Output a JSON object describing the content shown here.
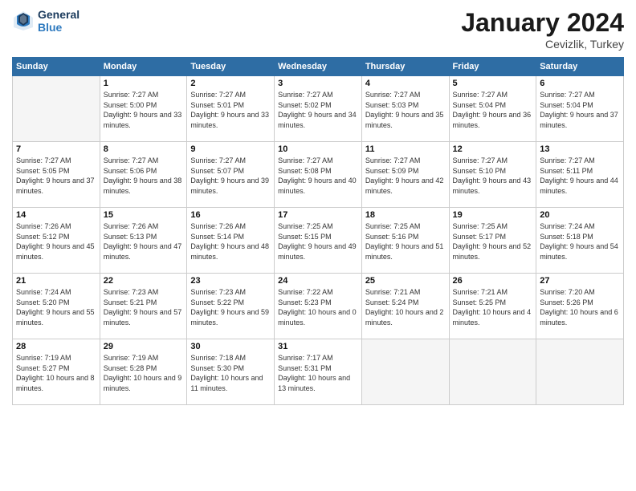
{
  "header": {
    "logo_line1": "General",
    "logo_line2": "Blue",
    "month": "January 2024",
    "location": "Cevizlik, Turkey"
  },
  "weekdays": [
    "Sunday",
    "Monday",
    "Tuesday",
    "Wednesday",
    "Thursday",
    "Friday",
    "Saturday"
  ],
  "weeks": [
    [
      {
        "day": "",
        "sunrise": "",
        "sunset": "",
        "daylight": ""
      },
      {
        "day": "1",
        "sunrise": "Sunrise: 7:27 AM",
        "sunset": "Sunset: 5:00 PM",
        "daylight": "Daylight: 9 hours and 33 minutes."
      },
      {
        "day": "2",
        "sunrise": "Sunrise: 7:27 AM",
        "sunset": "Sunset: 5:01 PM",
        "daylight": "Daylight: 9 hours and 33 minutes."
      },
      {
        "day": "3",
        "sunrise": "Sunrise: 7:27 AM",
        "sunset": "Sunset: 5:02 PM",
        "daylight": "Daylight: 9 hours and 34 minutes."
      },
      {
        "day": "4",
        "sunrise": "Sunrise: 7:27 AM",
        "sunset": "Sunset: 5:03 PM",
        "daylight": "Daylight: 9 hours and 35 minutes."
      },
      {
        "day": "5",
        "sunrise": "Sunrise: 7:27 AM",
        "sunset": "Sunset: 5:04 PM",
        "daylight": "Daylight: 9 hours and 36 minutes."
      },
      {
        "day": "6",
        "sunrise": "Sunrise: 7:27 AM",
        "sunset": "Sunset: 5:04 PM",
        "daylight": "Daylight: 9 hours and 37 minutes."
      }
    ],
    [
      {
        "day": "7",
        "sunrise": "Sunrise: 7:27 AM",
        "sunset": "Sunset: 5:05 PM",
        "daylight": "Daylight: 9 hours and 37 minutes."
      },
      {
        "day": "8",
        "sunrise": "Sunrise: 7:27 AM",
        "sunset": "Sunset: 5:06 PM",
        "daylight": "Daylight: 9 hours and 38 minutes."
      },
      {
        "day": "9",
        "sunrise": "Sunrise: 7:27 AM",
        "sunset": "Sunset: 5:07 PM",
        "daylight": "Daylight: 9 hours and 39 minutes."
      },
      {
        "day": "10",
        "sunrise": "Sunrise: 7:27 AM",
        "sunset": "Sunset: 5:08 PM",
        "daylight": "Daylight: 9 hours and 40 minutes."
      },
      {
        "day": "11",
        "sunrise": "Sunrise: 7:27 AM",
        "sunset": "Sunset: 5:09 PM",
        "daylight": "Daylight: 9 hours and 42 minutes."
      },
      {
        "day": "12",
        "sunrise": "Sunrise: 7:27 AM",
        "sunset": "Sunset: 5:10 PM",
        "daylight": "Daylight: 9 hours and 43 minutes."
      },
      {
        "day": "13",
        "sunrise": "Sunrise: 7:27 AM",
        "sunset": "Sunset: 5:11 PM",
        "daylight": "Daylight: 9 hours and 44 minutes."
      }
    ],
    [
      {
        "day": "14",
        "sunrise": "Sunrise: 7:26 AM",
        "sunset": "Sunset: 5:12 PM",
        "daylight": "Daylight: 9 hours and 45 minutes."
      },
      {
        "day": "15",
        "sunrise": "Sunrise: 7:26 AM",
        "sunset": "Sunset: 5:13 PM",
        "daylight": "Daylight: 9 hours and 47 minutes."
      },
      {
        "day": "16",
        "sunrise": "Sunrise: 7:26 AM",
        "sunset": "Sunset: 5:14 PM",
        "daylight": "Daylight: 9 hours and 48 minutes."
      },
      {
        "day": "17",
        "sunrise": "Sunrise: 7:25 AM",
        "sunset": "Sunset: 5:15 PM",
        "daylight": "Daylight: 9 hours and 49 minutes."
      },
      {
        "day": "18",
        "sunrise": "Sunrise: 7:25 AM",
        "sunset": "Sunset: 5:16 PM",
        "daylight": "Daylight: 9 hours and 51 minutes."
      },
      {
        "day": "19",
        "sunrise": "Sunrise: 7:25 AM",
        "sunset": "Sunset: 5:17 PM",
        "daylight": "Daylight: 9 hours and 52 minutes."
      },
      {
        "day": "20",
        "sunrise": "Sunrise: 7:24 AM",
        "sunset": "Sunset: 5:18 PM",
        "daylight": "Daylight: 9 hours and 54 minutes."
      }
    ],
    [
      {
        "day": "21",
        "sunrise": "Sunrise: 7:24 AM",
        "sunset": "Sunset: 5:20 PM",
        "daylight": "Daylight: 9 hours and 55 minutes."
      },
      {
        "day": "22",
        "sunrise": "Sunrise: 7:23 AM",
        "sunset": "Sunset: 5:21 PM",
        "daylight": "Daylight: 9 hours and 57 minutes."
      },
      {
        "day": "23",
        "sunrise": "Sunrise: 7:23 AM",
        "sunset": "Sunset: 5:22 PM",
        "daylight": "Daylight: 9 hours and 59 minutes."
      },
      {
        "day": "24",
        "sunrise": "Sunrise: 7:22 AM",
        "sunset": "Sunset: 5:23 PM",
        "daylight": "Daylight: 10 hours and 0 minutes."
      },
      {
        "day": "25",
        "sunrise": "Sunrise: 7:21 AM",
        "sunset": "Sunset: 5:24 PM",
        "daylight": "Daylight: 10 hours and 2 minutes."
      },
      {
        "day": "26",
        "sunrise": "Sunrise: 7:21 AM",
        "sunset": "Sunset: 5:25 PM",
        "daylight": "Daylight: 10 hours and 4 minutes."
      },
      {
        "day": "27",
        "sunrise": "Sunrise: 7:20 AM",
        "sunset": "Sunset: 5:26 PM",
        "daylight": "Daylight: 10 hours and 6 minutes."
      }
    ],
    [
      {
        "day": "28",
        "sunrise": "Sunrise: 7:19 AM",
        "sunset": "Sunset: 5:27 PM",
        "daylight": "Daylight: 10 hours and 8 minutes."
      },
      {
        "day": "29",
        "sunrise": "Sunrise: 7:19 AM",
        "sunset": "Sunset: 5:28 PM",
        "daylight": "Daylight: 10 hours and 9 minutes."
      },
      {
        "day": "30",
        "sunrise": "Sunrise: 7:18 AM",
        "sunset": "Sunset: 5:30 PM",
        "daylight": "Daylight: 10 hours and 11 minutes."
      },
      {
        "day": "31",
        "sunrise": "Sunrise: 7:17 AM",
        "sunset": "Sunset: 5:31 PM",
        "daylight": "Daylight: 10 hours and 13 minutes."
      },
      {
        "day": "",
        "sunrise": "",
        "sunset": "",
        "daylight": ""
      },
      {
        "day": "",
        "sunrise": "",
        "sunset": "",
        "daylight": ""
      },
      {
        "day": "",
        "sunrise": "",
        "sunset": "",
        "daylight": ""
      }
    ]
  ]
}
